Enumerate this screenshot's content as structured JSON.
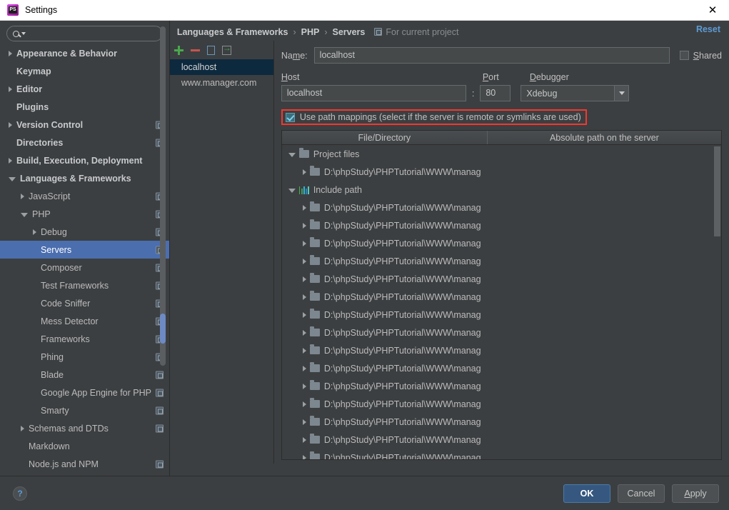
{
  "window": {
    "title": "Settings",
    "app_icon": "phpstorm-icon",
    "close_label": "✕"
  },
  "sidebar": {
    "search": {
      "placeholder": "",
      "value": "",
      "icon": "search-icon"
    },
    "items": [
      {
        "label": "Appearance & Behavior",
        "indent": 0,
        "arrow": "collapsed",
        "bold": true,
        "project_icon": false
      },
      {
        "label": "Keymap",
        "indent": 0,
        "arrow": "none",
        "bold": true,
        "project_icon": false
      },
      {
        "label": "Editor",
        "indent": 0,
        "arrow": "collapsed",
        "bold": true,
        "project_icon": false
      },
      {
        "label": "Plugins",
        "indent": 0,
        "arrow": "none",
        "bold": true,
        "project_icon": false
      },
      {
        "label": "Version Control",
        "indent": 0,
        "arrow": "collapsed",
        "bold": true,
        "project_icon": true
      },
      {
        "label": "Directories",
        "indent": 0,
        "arrow": "none",
        "bold": true,
        "project_icon": true
      },
      {
        "label": "Build, Execution, Deployment",
        "indent": 0,
        "arrow": "collapsed",
        "bold": true,
        "project_icon": false
      },
      {
        "label": "Languages & Frameworks",
        "indent": 0,
        "arrow": "expanded",
        "bold": true,
        "project_icon": false
      },
      {
        "label": "JavaScript",
        "indent": 1,
        "arrow": "collapsed",
        "bold": false,
        "project_icon": true
      },
      {
        "label": "PHP",
        "indent": 1,
        "arrow": "expanded",
        "bold": false,
        "project_icon": true
      },
      {
        "label": "Debug",
        "indent": 2,
        "arrow": "collapsed",
        "bold": false,
        "project_icon": true
      },
      {
        "label": "Servers",
        "indent": 2,
        "arrow": "none",
        "bold": false,
        "project_icon": true,
        "selected": true
      },
      {
        "label": "Composer",
        "indent": 2,
        "arrow": "none",
        "bold": false,
        "project_icon": true
      },
      {
        "label": "Test Frameworks",
        "indent": 2,
        "arrow": "none",
        "bold": false,
        "project_icon": true
      },
      {
        "label": "Code Sniffer",
        "indent": 2,
        "arrow": "none",
        "bold": false,
        "project_icon": true
      },
      {
        "label": "Mess Detector",
        "indent": 2,
        "arrow": "none",
        "bold": false,
        "project_icon": true
      },
      {
        "label": "Frameworks",
        "indent": 2,
        "arrow": "none",
        "bold": false,
        "project_icon": true
      },
      {
        "label": "Phing",
        "indent": 2,
        "arrow": "none",
        "bold": false,
        "project_icon": true
      },
      {
        "label": "Blade",
        "indent": 2,
        "arrow": "none",
        "bold": false,
        "project_icon": true
      },
      {
        "label": "Google App Engine for PHP",
        "indent": 2,
        "arrow": "none",
        "bold": false,
        "project_icon": true
      },
      {
        "label": "Smarty",
        "indent": 2,
        "arrow": "none",
        "bold": false,
        "project_icon": true
      },
      {
        "label": "Schemas and DTDs",
        "indent": 1,
        "arrow": "collapsed",
        "bold": false,
        "project_icon": true
      },
      {
        "label": "Markdown",
        "indent": 1,
        "arrow": "none",
        "bold": false,
        "project_icon": false
      },
      {
        "label": "Node.js and NPM",
        "indent": 1,
        "arrow": "none",
        "bold": false,
        "project_icon": true
      }
    ]
  },
  "breadcrumb": {
    "parts": [
      "Languages & Frameworks",
      "PHP",
      "Servers"
    ],
    "separator": "›",
    "scope_label": "For current project",
    "scope_icon": "project-scope-icon",
    "reset_label": "Reset"
  },
  "servers": {
    "toolbar": {
      "add": "add-server-button",
      "remove": "remove-server-button",
      "copy": "copy-server-button",
      "import": "import-server-button"
    },
    "items": [
      {
        "label": "localhost",
        "selected": true
      },
      {
        "label": "www.manager.com",
        "selected": false
      }
    ]
  },
  "form": {
    "name_label": "Name:",
    "name_mnemonic": "m",
    "name_value": "localhost",
    "shared_label": "Shared",
    "shared_mnemonic": "S",
    "shared_checked": false,
    "host_label": "Host",
    "host_mnemonic": "H",
    "host_value": "localhost",
    "colon": ":",
    "port_label": "Port",
    "port_mnemonic": "P",
    "port_value": "80",
    "debugger_label": "Debugger",
    "debugger_mnemonic": "D",
    "debugger_value": "Xdebug",
    "use_path_mappings_label": "Use path mappings (select if the server is remote or symlinks are used)",
    "use_path_mappings_checked": true,
    "highlight_color": "#f4372f"
  },
  "path_table": {
    "columns": [
      "File/Directory",
      "Absolute path on the server"
    ],
    "rows": [
      {
        "label": "Project files",
        "indent": 0,
        "arrow": "expanded",
        "icon": "folder-icon",
        "mapped": ""
      },
      {
        "label": "D:\\phpStudy\\PHPTutorial\\WWW\\manag",
        "indent": 1,
        "arrow": "collapsed",
        "icon": "folder-icon",
        "mapped": ""
      },
      {
        "label": "Include path",
        "indent": 0,
        "arrow": "expanded",
        "icon": "include-path-icon",
        "mapped": ""
      },
      {
        "label": "D:\\phpStudy\\PHPTutorial\\WWW\\manag",
        "indent": 1,
        "arrow": "collapsed",
        "icon": "folder-icon",
        "mapped": ""
      },
      {
        "label": "D:\\phpStudy\\PHPTutorial\\WWW\\manag",
        "indent": 1,
        "arrow": "collapsed",
        "icon": "folder-icon",
        "mapped": ""
      },
      {
        "label": "D:\\phpStudy\\PHPTutorial\\WWW\\manag",
        "indent": 1,
        "arrow": "collapsed",
        "icon": "folder-icon",
        "mapped": ""
      },
      {
        "label": "D:\\phpStudy\\PHPTutorial\\WWW\\manag",
        "indent": 1,
        "arrow": "collapsed",
        "icon": "folder-icon",
        "mapped": ""
      },
      {
        "label": "D:\\phpStudy\\PHPTutorial\\WWW\\manag",
        "indent": 1,
        "arrow": "collapsed",
        "icon": "folder-icon",
        "mapped": ""
      },
      {
        "label": "D:\\phpStudy\\PHPTutorial\\WWW\\manag",
        "indent": 1,
        "arrow": "collapsed",
        "icon": "folder-icon",
        "mapped": ""
      },
      {
        "label": "D:\\phpStudy\\PHPTutorial\\WWW\\manag",
        "indent": 1,
        "arrow": "collapsed",
        "icon": "folder-icon",
        "mapped": ""
      },
      {
        "label": "D:\\phpStudy\\PHPTutorial\\WWW\\manag",
        "indent": 1,
        "arrow": "collapsed",
        "icon": "folder-icon",
        "mapped": ""
      },
      {
        "label": "D:\\phpStudy\\PHPTutorial\\WWW\\manag",
        "indent": 1,
        "arrow": "collapsed",
        "icon": "folder-icon",
        "mapped": ""
      },
      {
        "label": "D:\\phpStudy\\PHPTutorial\\WWW\\manag",
        "indent": 1,
        "arrow": "collapsed",
        "icon": "folder-icon",
        "mapped": ""
      },
      {
        "label": "D:\\phpStudy\\PHPTutorial\\WWW\\manag",
        "indent": 1,
        "arrow": "collapsed",
        "icon": "folder-icon",
        "mapped": ""
      },
      {
        "label": "D:\\phpStudy\\PHPTutorial\\WWW\\manag",
        "indent": 1,
        "arrow": "collapsed",
        "icon": "folder-icon",
        "mapped": ""
      },
      {
        "label": "D:\\phpStudy\\PHPTutorial\\WWW\\manag",
        "indent": 1,
        "arrow": "collapsed",
        "icon": "folder-icon",
        "mapped": ""
      },
      {
        "label": "D:\\phpStudy\\PHPTutorial\\WWW\\manag",
        "indent": 1,
        "arrow": "collapsed",
        "icon": "folder-icon",
        "mapped": ""
      },
      {
        "label": "D:\\phpStudy\\PHPTutorial\\WWW\\manag",
        "indent": 1,
        "arrow": "collapsed",
        "icon": "folder-icon",
        "mapped": ""
      }
    ]
  },
  "footer": {
    "help_label": "?",
    "ok_label": "OK",
    "cancel_label": "Cancel",
    "apply_label": "Apply",
    "apply_mnemonic": "A"
  }
}
